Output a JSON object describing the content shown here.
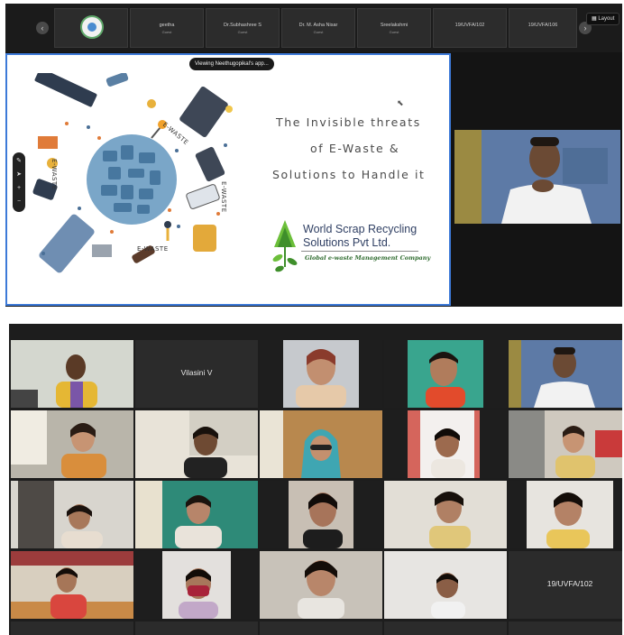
{
  "meeting_toolbar": {
    "prev_arrow": "‹",
    "next_arrow": "›",
    "layout_label": "Layout",
    "participants": [
      {
        "name": "",
        "sub": ""
      },
      {
        "name": "geetha",
        "sub": "Guest"
      },
      {
        "name": "Dr.Subhashree S",
        "sub": "Guest"
      },
      {
        "name": "Dr. M. Asha Nisar",
        "sub": "Guest"
      },
      {
        "name": "Sreelakshmi",
        "sub": "Guest"
      },
      {
        "name": "19/UVFA/102",
        "sub": ""
      },
      {
        "name": "19/UVFA/106",
        "sub": ""
      }
    ]
  },
  "presentation": {
    "viewing_banner": "Viewing Neethugopikal's app...",
    "title_lines": [
      "The Invisible threats",
      "of E-Waste &",
      "Solutions to Handle it"
    ],
    "ewaste_tags": [
      "E-WASTE",
      "E-WASTE",
      "E-WASTE",
      "E-WASTE"
    ],
    "company_name_lines": [
      "World Scrap Recycling",
      "Solutions Pvt Ltd."
    ],
    "company_tagline": "Global e-waste Management Company",
    "tool_icons": [
      "pen-icon",
      "pointer-icon",
      "zoom-in-icon",
      "zoom-out-icon"
    ]
  },
  "gallery": {
    "named_tiles": [
      {
        "name": "Vilasini V"
      },
      {
        "name": "19/UVFA/102"
      }
    ]
  },
  "colors": {
    "slide_border": "#3d7ad8",
    "meeting_bg": "#1b1b1b",
    "company_green": "#2e6b2e",
    "company_blue": "#2f3f63"
  }
}
